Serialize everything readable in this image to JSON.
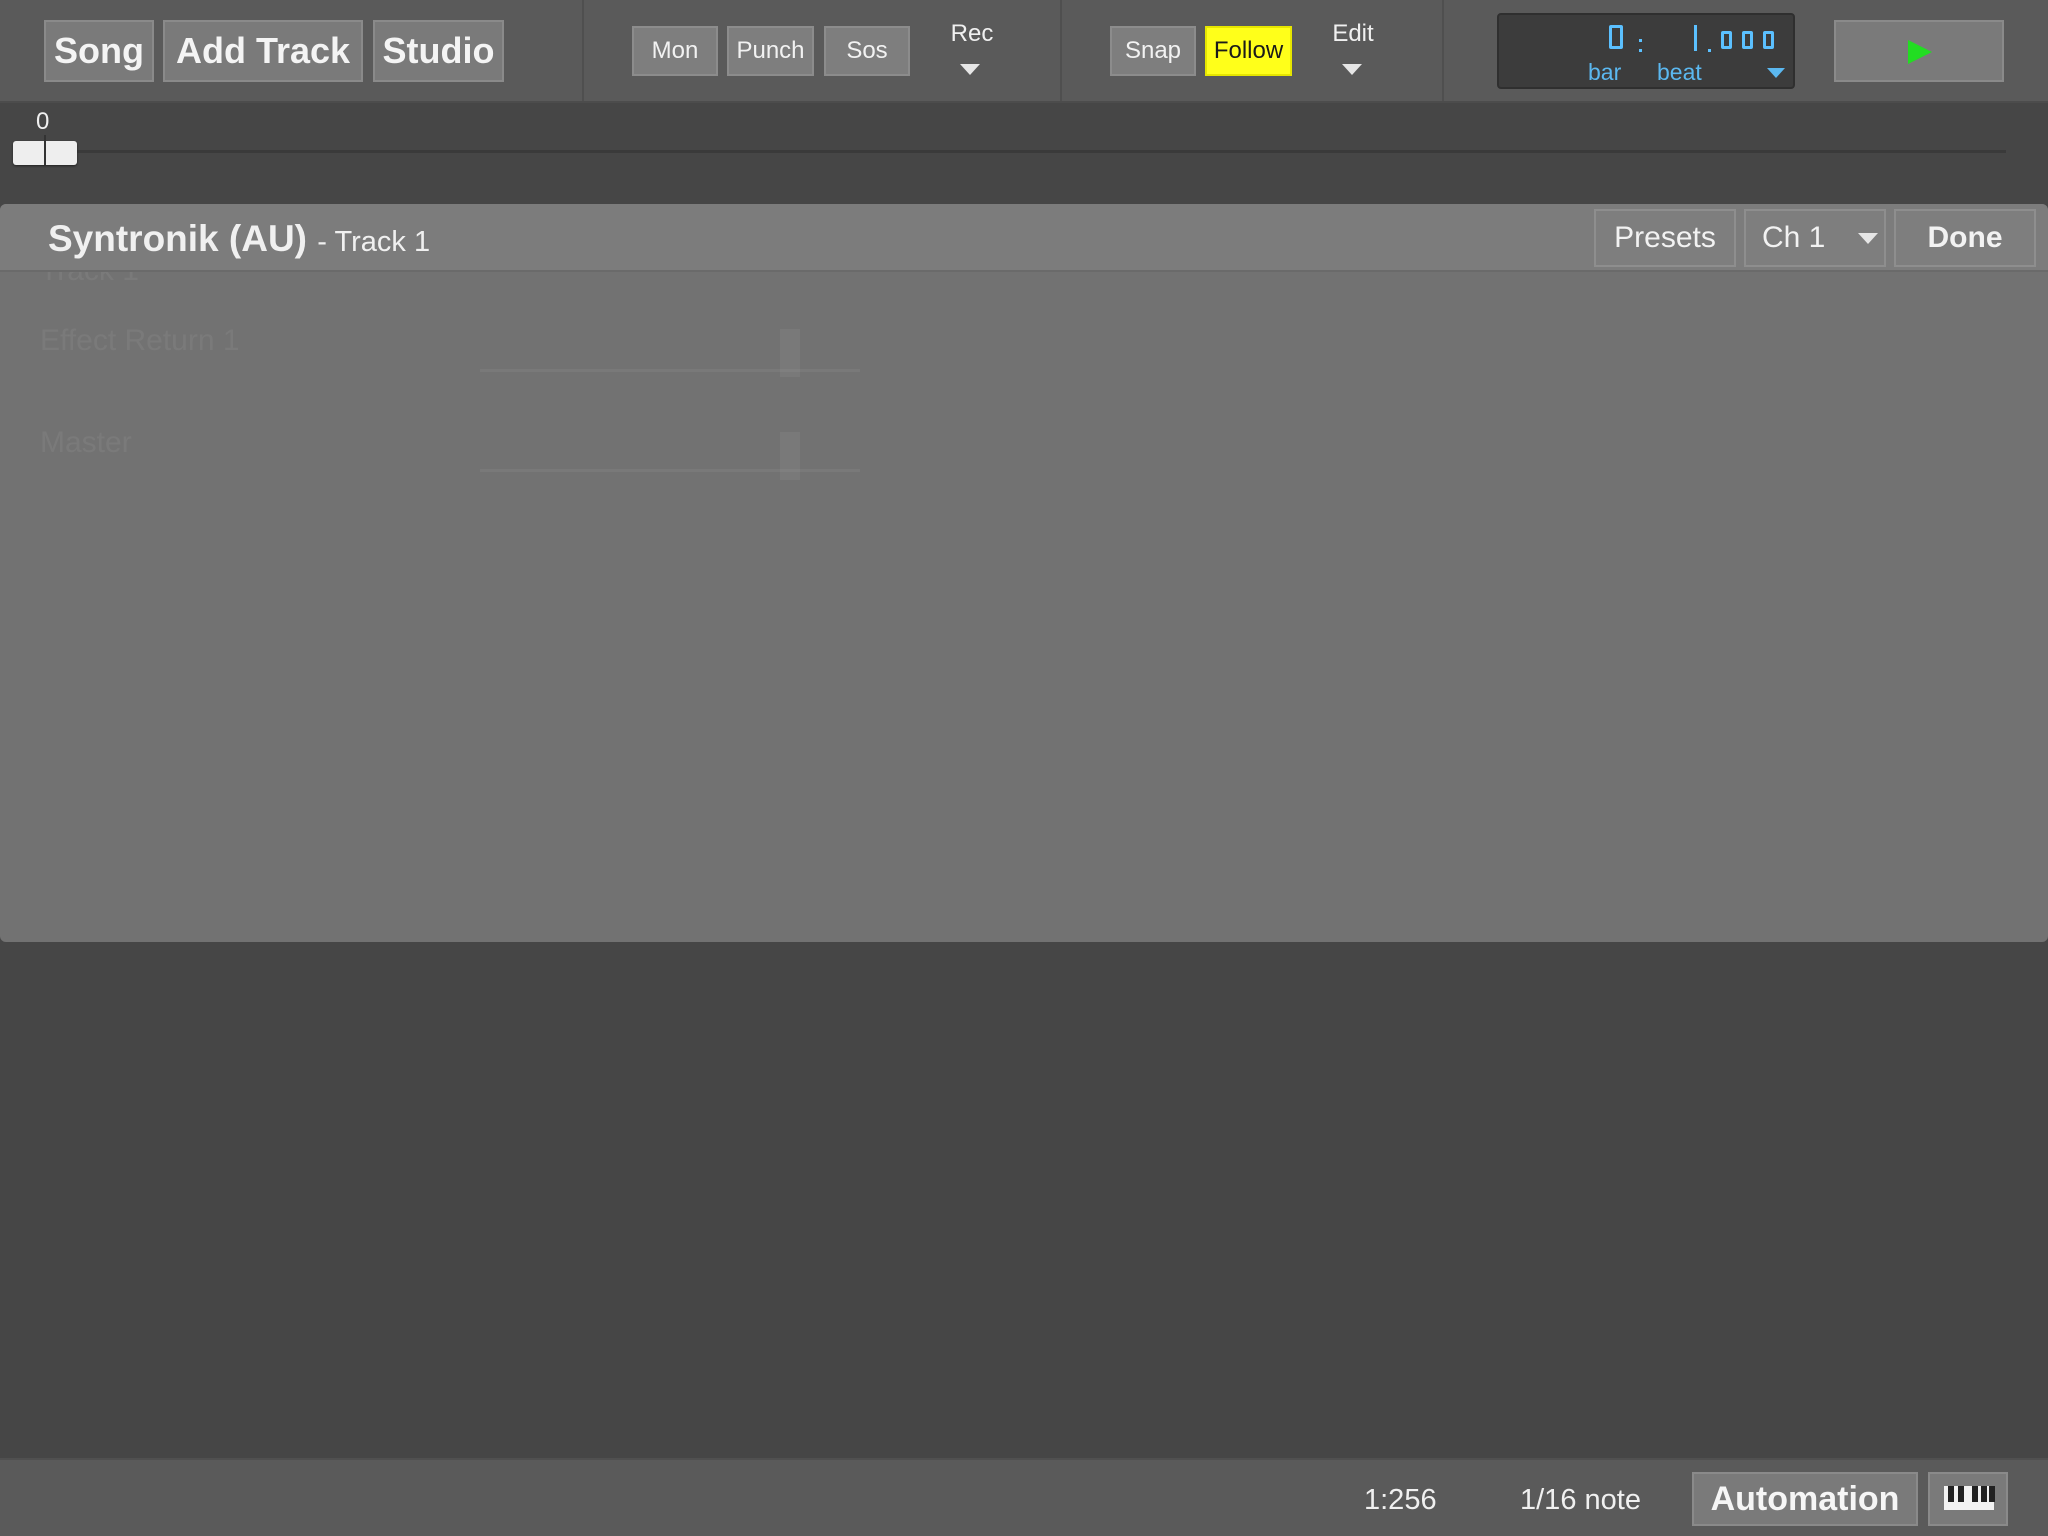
{
  "toolbar": {
    "nav": {
      "song": "Song",
      "add_track": "Add Track",
      "studio": "Studio"
    },
    "record": {
      "mon": "Mon",
      "punch": "Punch",
      "sos": "Sos",
      "rec": "Rec"
    },
    "edit": {
      "snap": "Snap",
      "follow": "Follow",
      "edit": "Edit",
      "follow_active": true
    },
    "time_display": {
      "bar_label": "bar",
      "beat_label": "beat"
    }
  },
  "timeline": {
    "position_label": "0"
  },
  "plugin": {
    "name": "Syntronik (AU)",
    "track": "- Track 1",
    "presets_label": "Presets",
    "channel_label": "Ch 1",
    "done_label": "Done"
  },
  "status": {
    "zoom": "1:256",
    "quantize": "1/16 note",
    "automation_label": "Automation",
    "piano_icon": "piano-keyboard-icon"
  },
  "colors": {
    "accent_follow": "#ffff1a",
    "time_digits": "#5bc0ff",
    "play": "#22dd22"
  }
}
